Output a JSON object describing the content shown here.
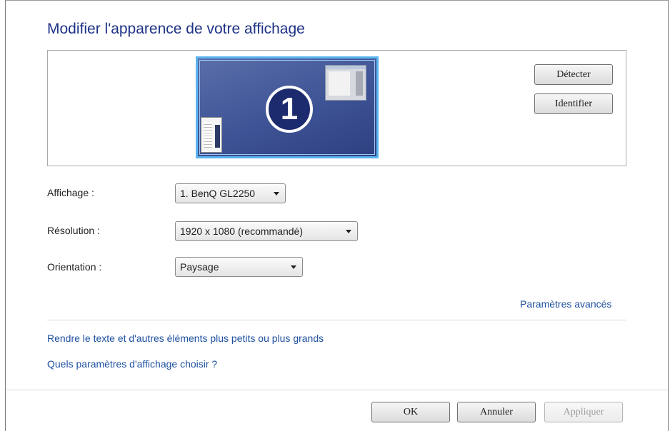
{
  "title": "Modifier l'apparence de votre affichage",
  "preview": {
    "monitor_number": "1"
  },
  "buttons": {
    "detect": "Détecter",
    "identify": "Identifier",
    "ok": "OK",
    "cancel": "Annuler",
    "apply": "Appliquer"
  },
  "fields": {
    "display_label": "Affichage :",
    "display_value": "1. BenQ GL2250",
    "resolution_label": "Résolution :",
    "resolution_value": "1920 x 1080 (recommandé)",
    "orientation_label": "Orientation :",
    "orientation_value": "Paysage"
  },
  "links": {
    "advanced": "Paramètres avancés",
    "text_size": "Rendre le texte et d'autres éléments plus petits ou plus grands",
    "which_settings": "Quels paramètres d'affichage choisir ?"
  },
  "colors": {
    "title": "#1e3287",
    "link": "#1e50a0",
    "monitor_border": "#5ab4f0"
  },
  "icons": [
    "monitor-preview-icon",
    "chevron-down-icon"
  ]
}
